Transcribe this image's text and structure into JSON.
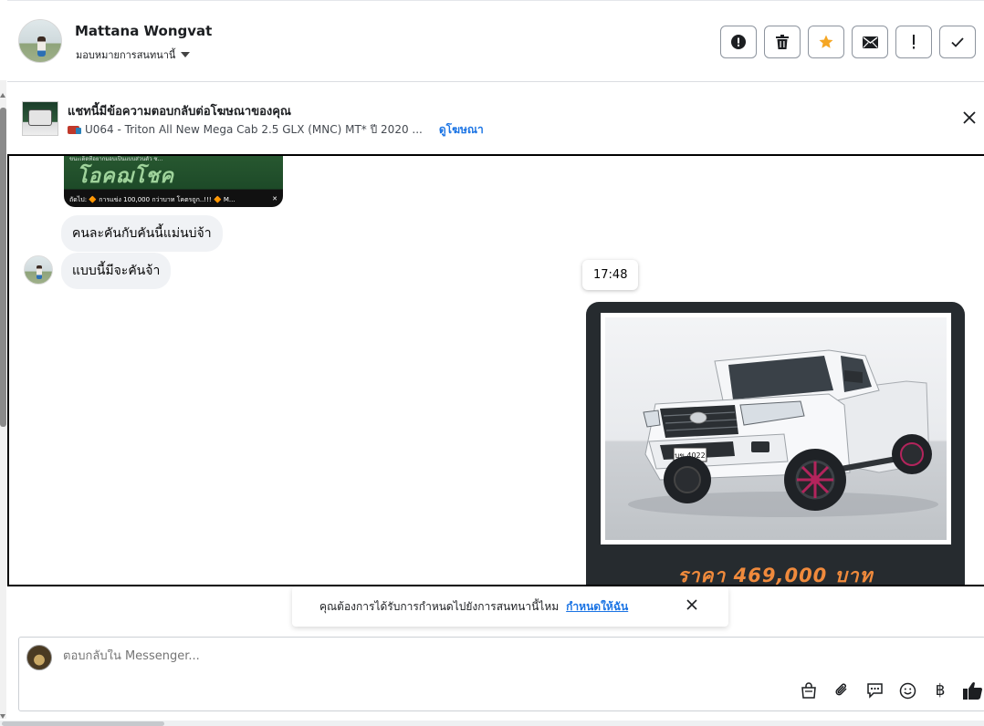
{
  "header": {
    "contact_name": "Mattana Wongvat",
    "assign_label": "มอบหมายการสนทนานี้",
    "action_buttons": [
      "report-icon",
      "trash-icon",
      "star-icon",
      "mail-icon",
      "exclamation-icon",
      "check-icon"
    ]
  },
  "ad_banner": {
    "title": "แชทนี้มีข้อความตอบกลับต่อโฆษณาของคุณ",
    "ad_description": "U064 - Triton All New Mega Cab 2.5 GLX (MNC) MT* ปี 2020 ...",
    "view_ad_link": "ดูโฆษณา"
  },
  "chat": {
    "media_headline": "ขนะเด็ดที่อยากมอบเป็นแบบส่วนตัว ซ...",
    "media_bigtext": "โอคฌโชค",
    "media_caption": "ถัดไป: 🔶 การแข่ง 100,000 กว่าบาท โคตรถูก..!!! 🔶 M...",
    "messages": [
      {
        "text": "คนละคันกับคันนี้แม่นบ่จ้า"
      },
      {
        "text": "แบบนี้มีจะคันจ้า"
      }
    ],
    "timestamp": "17:48",
    "car_plate": "บข 4022",
    "price_text": "ราคา 469,000 บาท"
  },
  "prompt": {
    "text": "คุณต้องการได้รับการกำหนดไปยังการสนทนานี้ไหม",
    "link": "กำหนดให้ฉัน"
  },
  "composer": {
    "placeholder": "ตอบกลับใน Messenger...",
    "tools": [
      "shopping-bag-icon",
      "attach-icon",
      "chat-bubble-icon",
      "emoji-icon",
      "baht-icon",
      "like-icon"
    ],
    "baht_symbol": "฿"
  },
  "colors": {
    "accent": "#1b74e4",
    "star": "#f5a623",
    "bubble": "#f0f2f5",
    "price": "#f08a3c"
  }
}
